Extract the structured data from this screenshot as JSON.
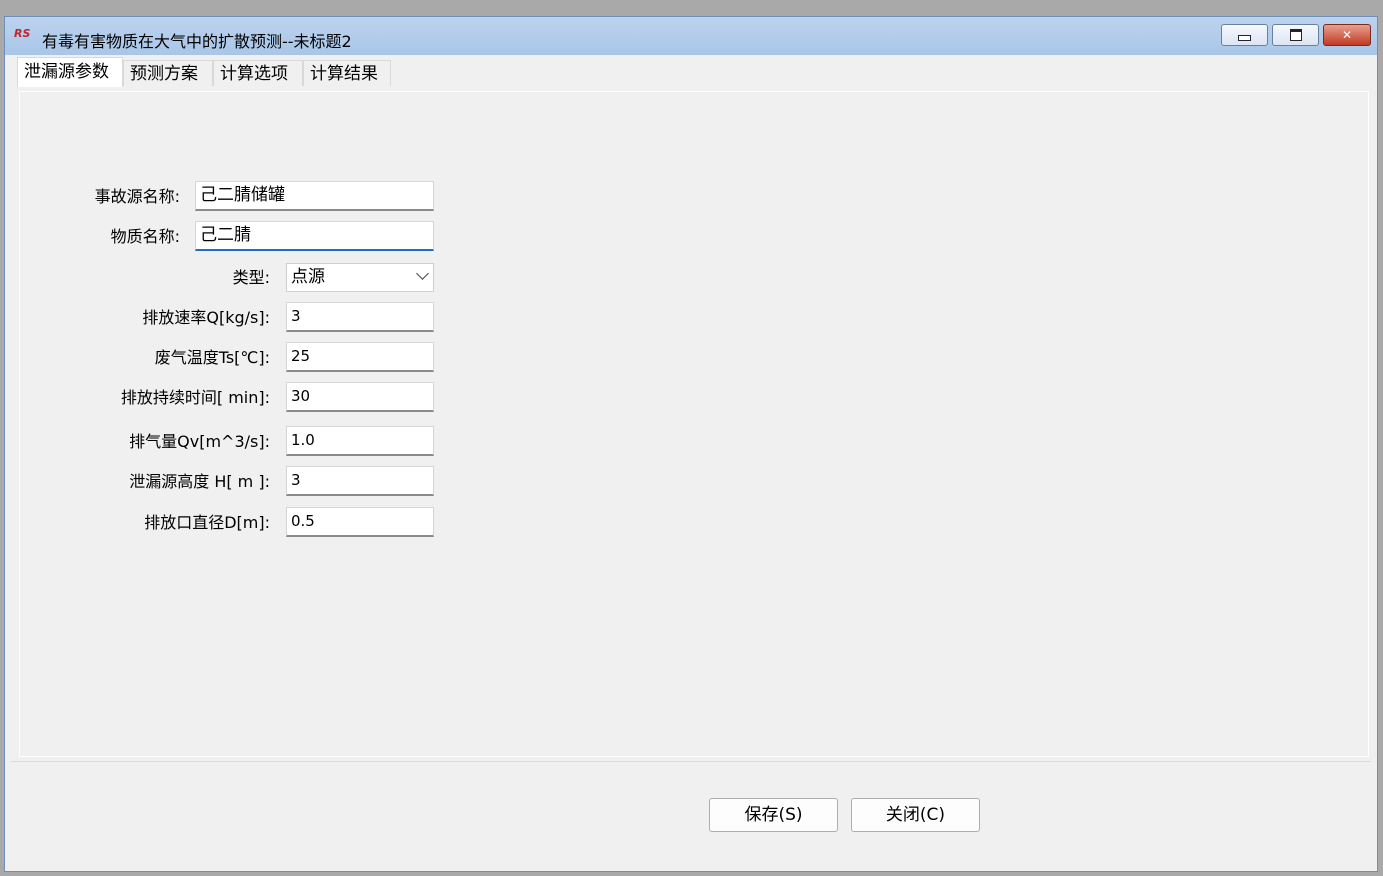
{
  "window": {
    "app_icon_text": "RS",
    "title": "有毒有害物质在大气中的扩散预测--未标题2"
  },
  "tabs": [
    {
      "label": "泄漏源参数"
    },
    {
      "label": "预测方案"
    },
    {
      "label": "计算选项"
    },
    {
      "label": "计算结果"
    }
  ],
  "form": {
    "source_name_label": "事故源名称:",
    "source_name_value": "己二腈储罐",
    "substance_label": "物质名称:",
    "substance_value": "己二腈",
    "type_label": "类型:",
    "type_value": "点源",
    "rate_label": "排放速率Q[kg/s]:",
    "rate_value": "3",
    "temp_label": "废气温度Ts[℃]:",
    "temp_value": "25",
    "duration_label": "排放持续时间[ min]:",
    "duration_value": "30",
    "flow_label": "排气量Qv[m^3/s]:",
    "flow_value": "1.0",
    "height_label": "泄漏源高度 H[  m ]:",
    "height_value": "3",
    "diameter_label": "排放口直径D[m]:",
    "diameter_value": "0.5"
  },
  "buttons": {
    "save": "保存(S)",
    "close": "关闭(C)"
  }
}
